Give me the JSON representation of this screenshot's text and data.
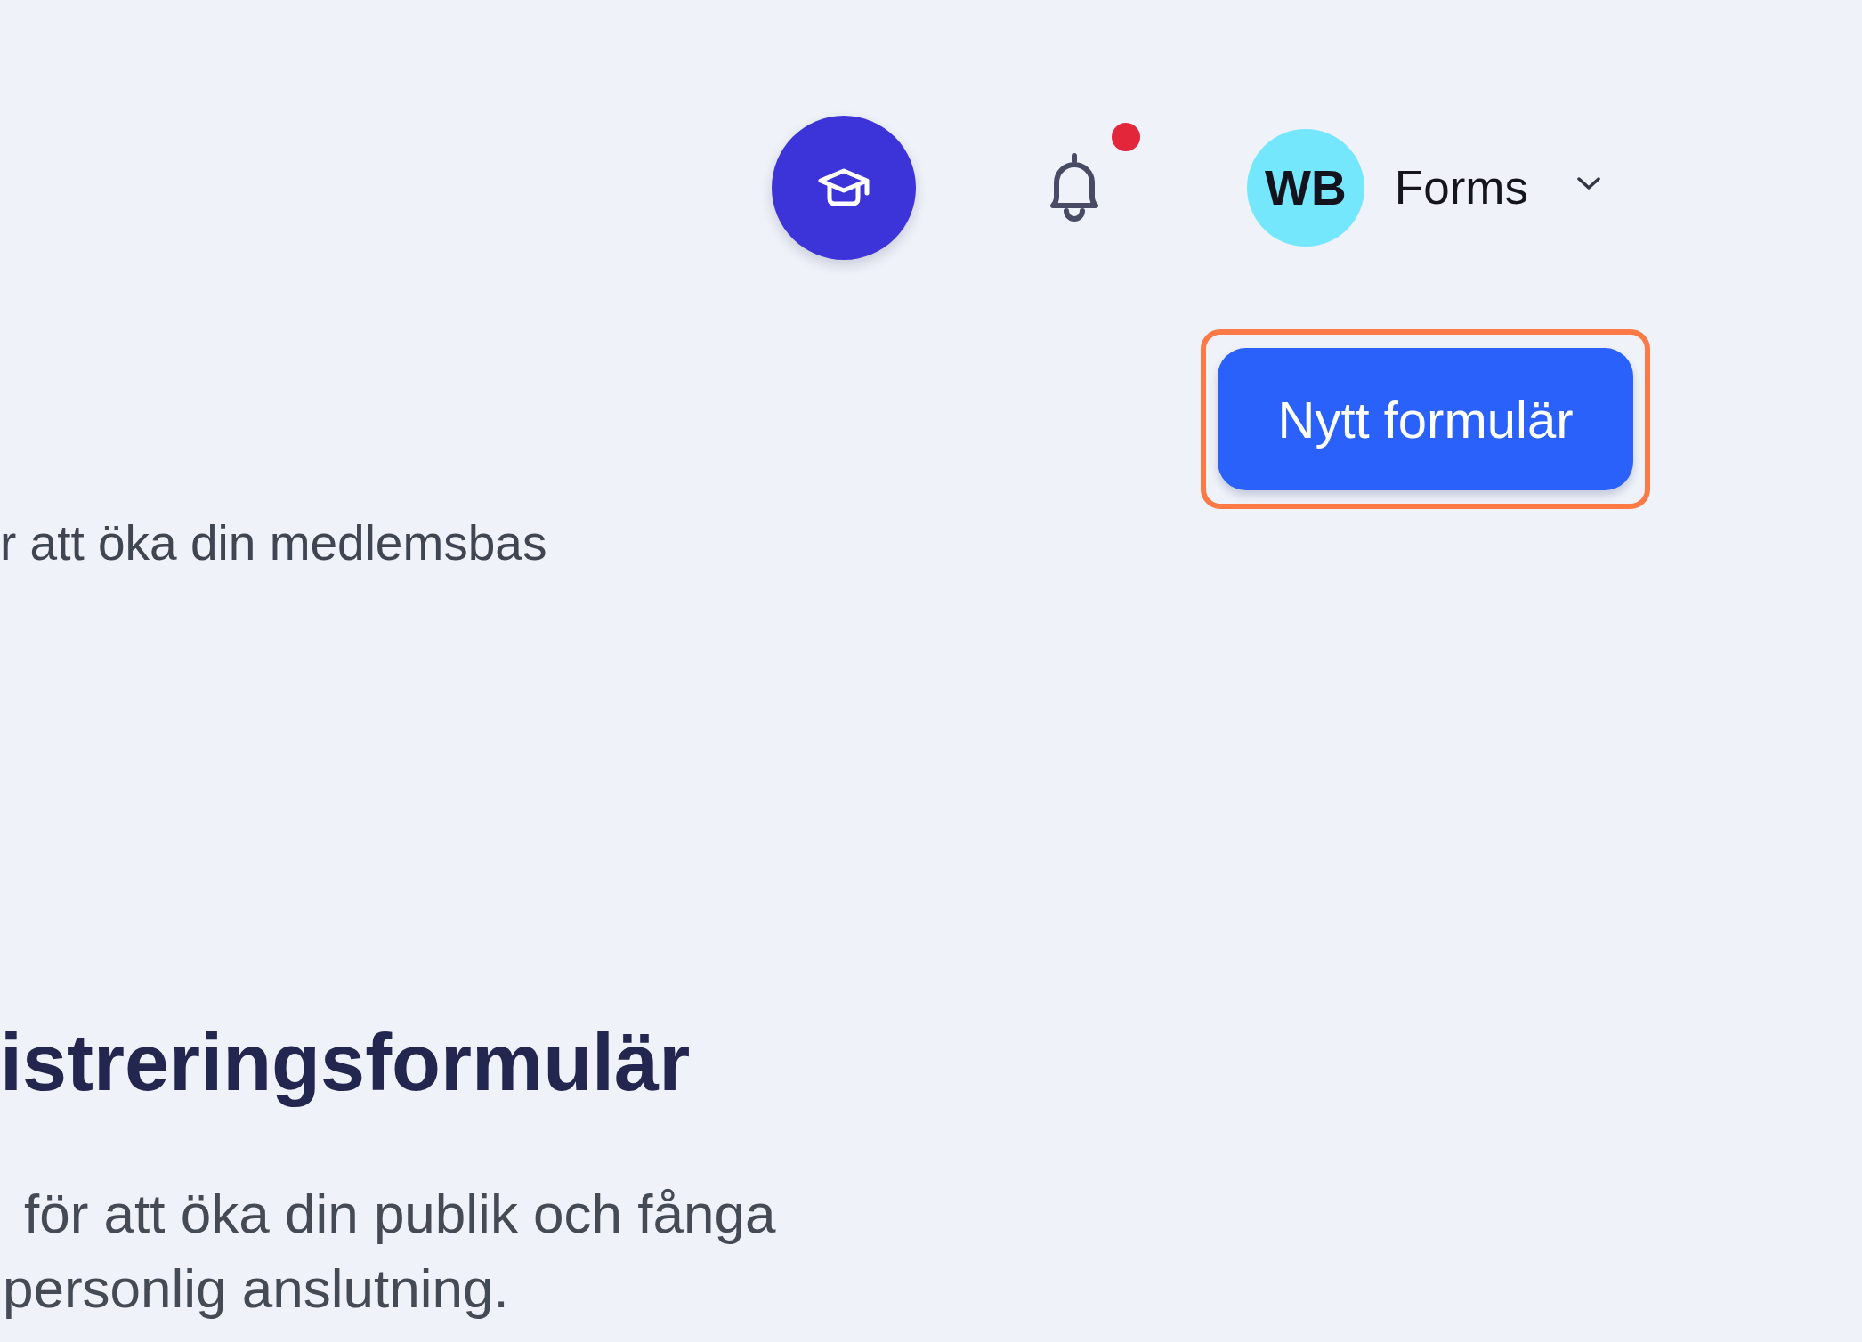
{
  "header": {
    "notifications": {
      "unread": true
    },
    "account": {
      "initials": "WB",
      "name": "Forms"
    }
  },
  "toolbar": {
    "new_form_button": {
      "label": "Nytt formulär",
      "highlighted": true
    }
  },
  "intro": {
    "text": "r att öka din medlemsbas"
  },
  "section": {
    "title": "istreringsformulär",
    "description_lines": [
      "för att öka din publik och fånga",
      "personlig anslutning."
    ]
  }
}
